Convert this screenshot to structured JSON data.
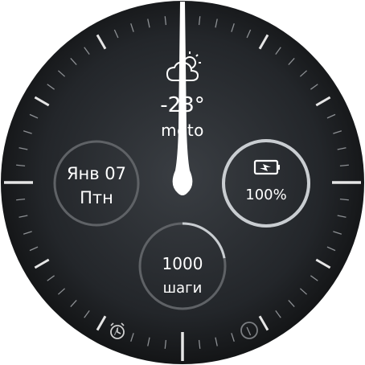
{
  "colors": {
    "dial": "#2a2d31",
    "dial_edge": "#0b0c0d",
    "tick": "#d8d8d8",
    "text": "#ffffff",
    "ring": "#6e7175",
    "progress": "#bfc3c7"
  },
  "brand": "moto",
  "weather": {
    "icon": "partly-cloudy-icon",
    "temperature": "-23°"
  },
  "date": {
    "month_day": "Янв 07",
    "weekday": "Птн"
  },
  "battery": {
    "icon": "battery-charging-icon",
    "level": "100%",
    "level_fraction": 1.0
  },
  "steps": {
    "count": "1000",
    "label": "шаги",
    "progress_fraction": 0.22
  },
  "bottom_icons": [
    "alarm-icon",
    "circle-icon"
  ]
}
